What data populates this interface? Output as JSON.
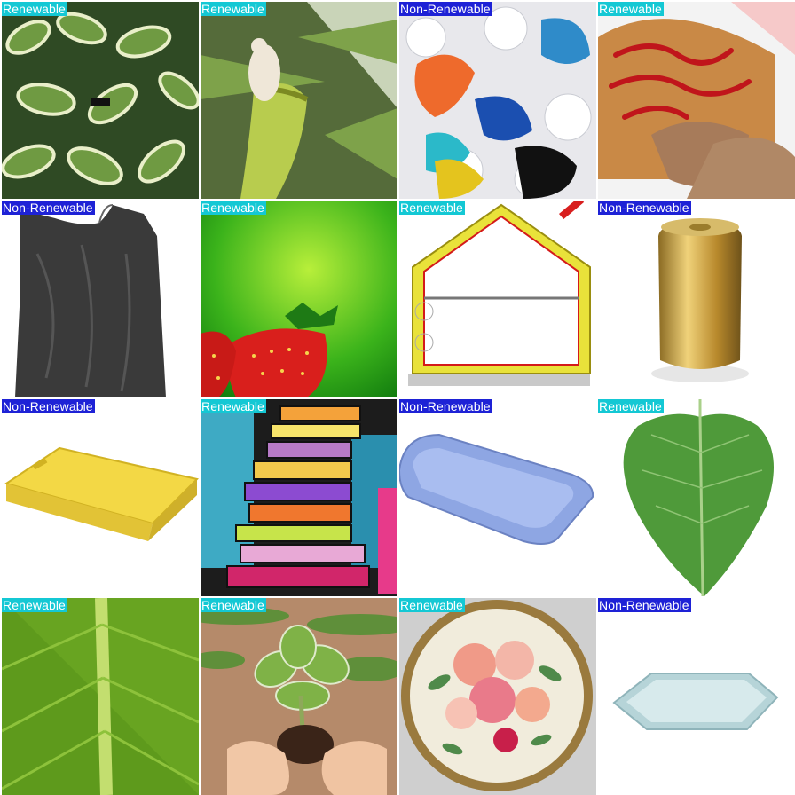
{
  "label_colors": {
    "Renewable": "#14c8d4",
    "Non-Renewable": "#1e22d6"
  },
  "tiles": [
    {
      "label": "Renewable",
      "subject": "hosta-plant"
    },
    {
      "label": "Renewable",
      "subject": "pitcher-plant-with-mouse"
    },
    {
      "label": "Non-Renewable",
      "subject": "plastic-bags-pile"
    },
    {
      "label": "Renewable",
      "subject": "meatloaf"
    },
    {
      "label": "Non-Renewable",
      "subject": "black-plastic-bag"
    },
    {
      "label": "Renewable",
      "subject": "strawberries"
    },
    {
      "label": "Renewable",
      "subject": "insulated-house-diagram"
    },
    {
      "label": "Non-Renewable",
      "subject": "gold-can"
    },
    {
      "label": "Non-Renewable",
      "subject": "yellow-plastic-tray"
    },
    {
      "label": "Renewable",
      "subject": "book-stack"
    },
    {
      "label": "Non-Renewable",
      "subject": "blue-plastic-tray"
    },
    {
      "label": "Renewable",
      "subject": "green-leaf"
    },
    {
      "label": "Renewable",
      "subject": "leaf-closeup"
    },
    {
      "label": "Renewable",
      "subject": "seedling-in-hands"
    },
    {
      "label": "Renewable",
      "subject": "floral-round-tray"
    },
    {
      "label": "Non-Renewable",
      "subject": "hexagonal-tray"
    }
  ]
}
